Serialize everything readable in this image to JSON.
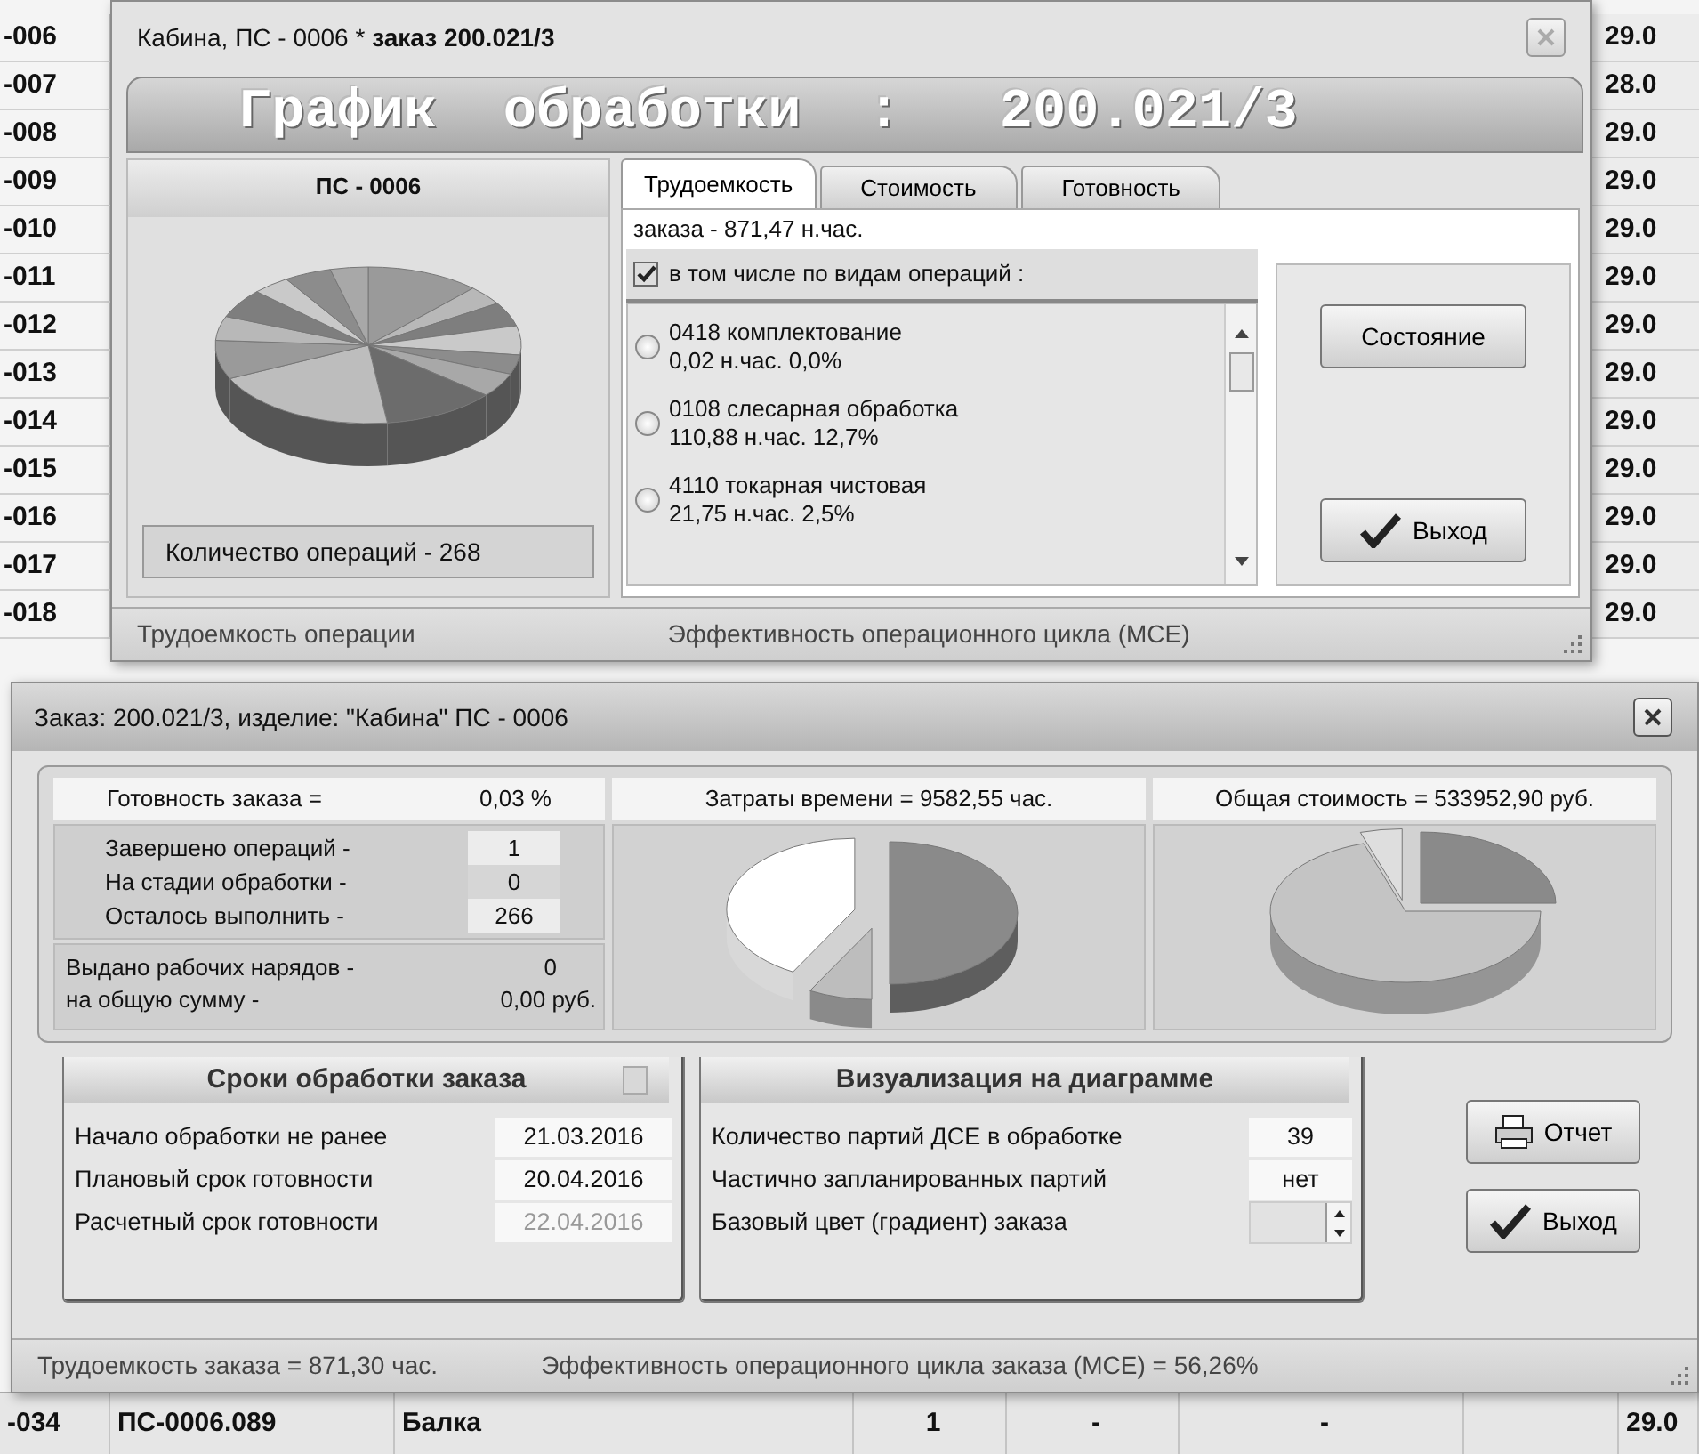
{
  "background_table": {
    "rows": [
      {
        "code": "-006",
        "date": "29.0"
      },
      {
        "code": "-007",
        "date": "28.0"
      },
      {
        "code": "-008",
        "date": "29.0"
      },
      {
        "code": "-009",
        "date": "29.0"
      },
      {
        "code": "-010",
        "date": "29.0"
      },
      {
        "code": "-011",
        "date": "29.0"
      },
      {
        "code": "-012",
        "date": "29.0"
      },
      {
        "code": "-013",
        "date": "29.0"
      },
      {
        "code": "-014",
        "date": "29.0"
      },
      {
        "code": "-015",
        "date": "29.0"
      },
      {
        "code": "-016",
        "date": "29.0"
      },
      {
        "code": "-017",
        "date": "29.0"
      },
      {
        "code": "-018",
        "date": "29.0"
      }
    ],
    "bottom_row": {
      "code": "-034",
      "designation": "ПС-0006.089",
      "name": "Балка",
      "quantity": "1",
      "column_5": "-",
      "column_6": "-",
      "date": "29.0"
    }
  },
  "schedule_window": {
    "title": "Кабина,  ПС - 0006  * **заказ 200.021/3**",
    "banner": "График  обработки  :   200.021/3",
    "left_panel": {
      "heading": "ПС - 0006",
      "operations_count": "Количество операций  -  268"
    },
    "tabs": [
      {
        "label": "Трудоемкость",
        "selected": true
      },
      {
        "label": "Стоимость",
        "selected": false
      },
      {
        "label": "Готовность",
        "selected": false
      }
    ],
    "total": "заказа  - 871,47 н.час.",
    "by_type": {
      "label": "в том числе по видам операций :",
      "checked": true
    },
    "operations": [
      {
        "name": "0418 комплектование",
        "value": "0,02 н.час.  0,0%",
        "selected": false
      },
      {
        "name": "0108 слесарная обработка",
        "value": "110,88 н.час.  12,7%",
        "selected": false
      },
      {
        "name": "4110 токарная чистовая",
        "value": "21,75 н.час.  2,5%",
        "selected": false
      }
    ],
    "buttons": [
      {
        "label": "Состояние",
        "kind": "plain"
      },
      {
        "label": "Выход",
        "kind": "exit"
      }
    ],
    "status_bar": [
      "Трудоемкость операции",
      "Эффективность операционного цикла (МСЕ)"
    ]
  },
  "order_window": {
    "title": "Заказ: 200.021/3,  изделие: \"Кабина\"  ПС - 0006",
    "readiness": {
      "label": "Готовность заказа =",
      "value": "0,03 %"
    },
    "counts": [
      {
        "label": "Завершено операций  -",
        "value": "1"
      },
      {
        "label": "На стадии обработки  -",
        "value": "0"
      },
      {
        "label": "Осталось выполнить -",
        "value": "266"
      }
    ],
    "work_orders": [
      {
        "label": "Выдано рабочих нарядов  -",
        "value": "0"
      },
      {
        "label": "на общую сумму  -",
        "value": "0,00 руб."
      }
    ],
    "time_heading": "Затраты времени = 9582,55 час.",
    "cost_heading": "Общая стоимость = 533952,90 руб.",
    "deadlines": {
      "heading": "Сроки обработки заказа",
      "checked": false,
      "rows": [
        {
          "label": "Начало обработки не ранее",
          "value": "21.03.2016",
          "disabled": false
        },
        {
          "label": "Плановый  срок готовности",
          "value": "20.04.2016",
          "disabled": false
        },
        {
          "label": "Расчетный срок готовности",
          "value": "22.04.2016",
          "disabled": true
        }
      ]
    },
    "visualization": {
      "heading": "Визуализация на диаграмме",
      "rows": [
        {
          "label": "Количество партий ДСЕ в обработке",
          "value": "39",
          "kind": "text"
        },
        {
          "label": "Частично запланированных партий",
          "value": "нет",
          "kind": "text"
        },
        {
          "label": "Базовый цвет (градиент)  заказа",
          "kind": "spinner"
        }
      ]
    },
    "buttons": [
      {
        "label": "Отчет",
        "kind": "report"
      },
      {
        "label": "Выход",
        "kind": "exit"
      }
    ],
    "status_bar": [
      "Трудоемкость заказа = 871,30 час.",
      "Эффективность операционного цикла заказа (МСЕ) =   56,26%"
    ]
  }
}
